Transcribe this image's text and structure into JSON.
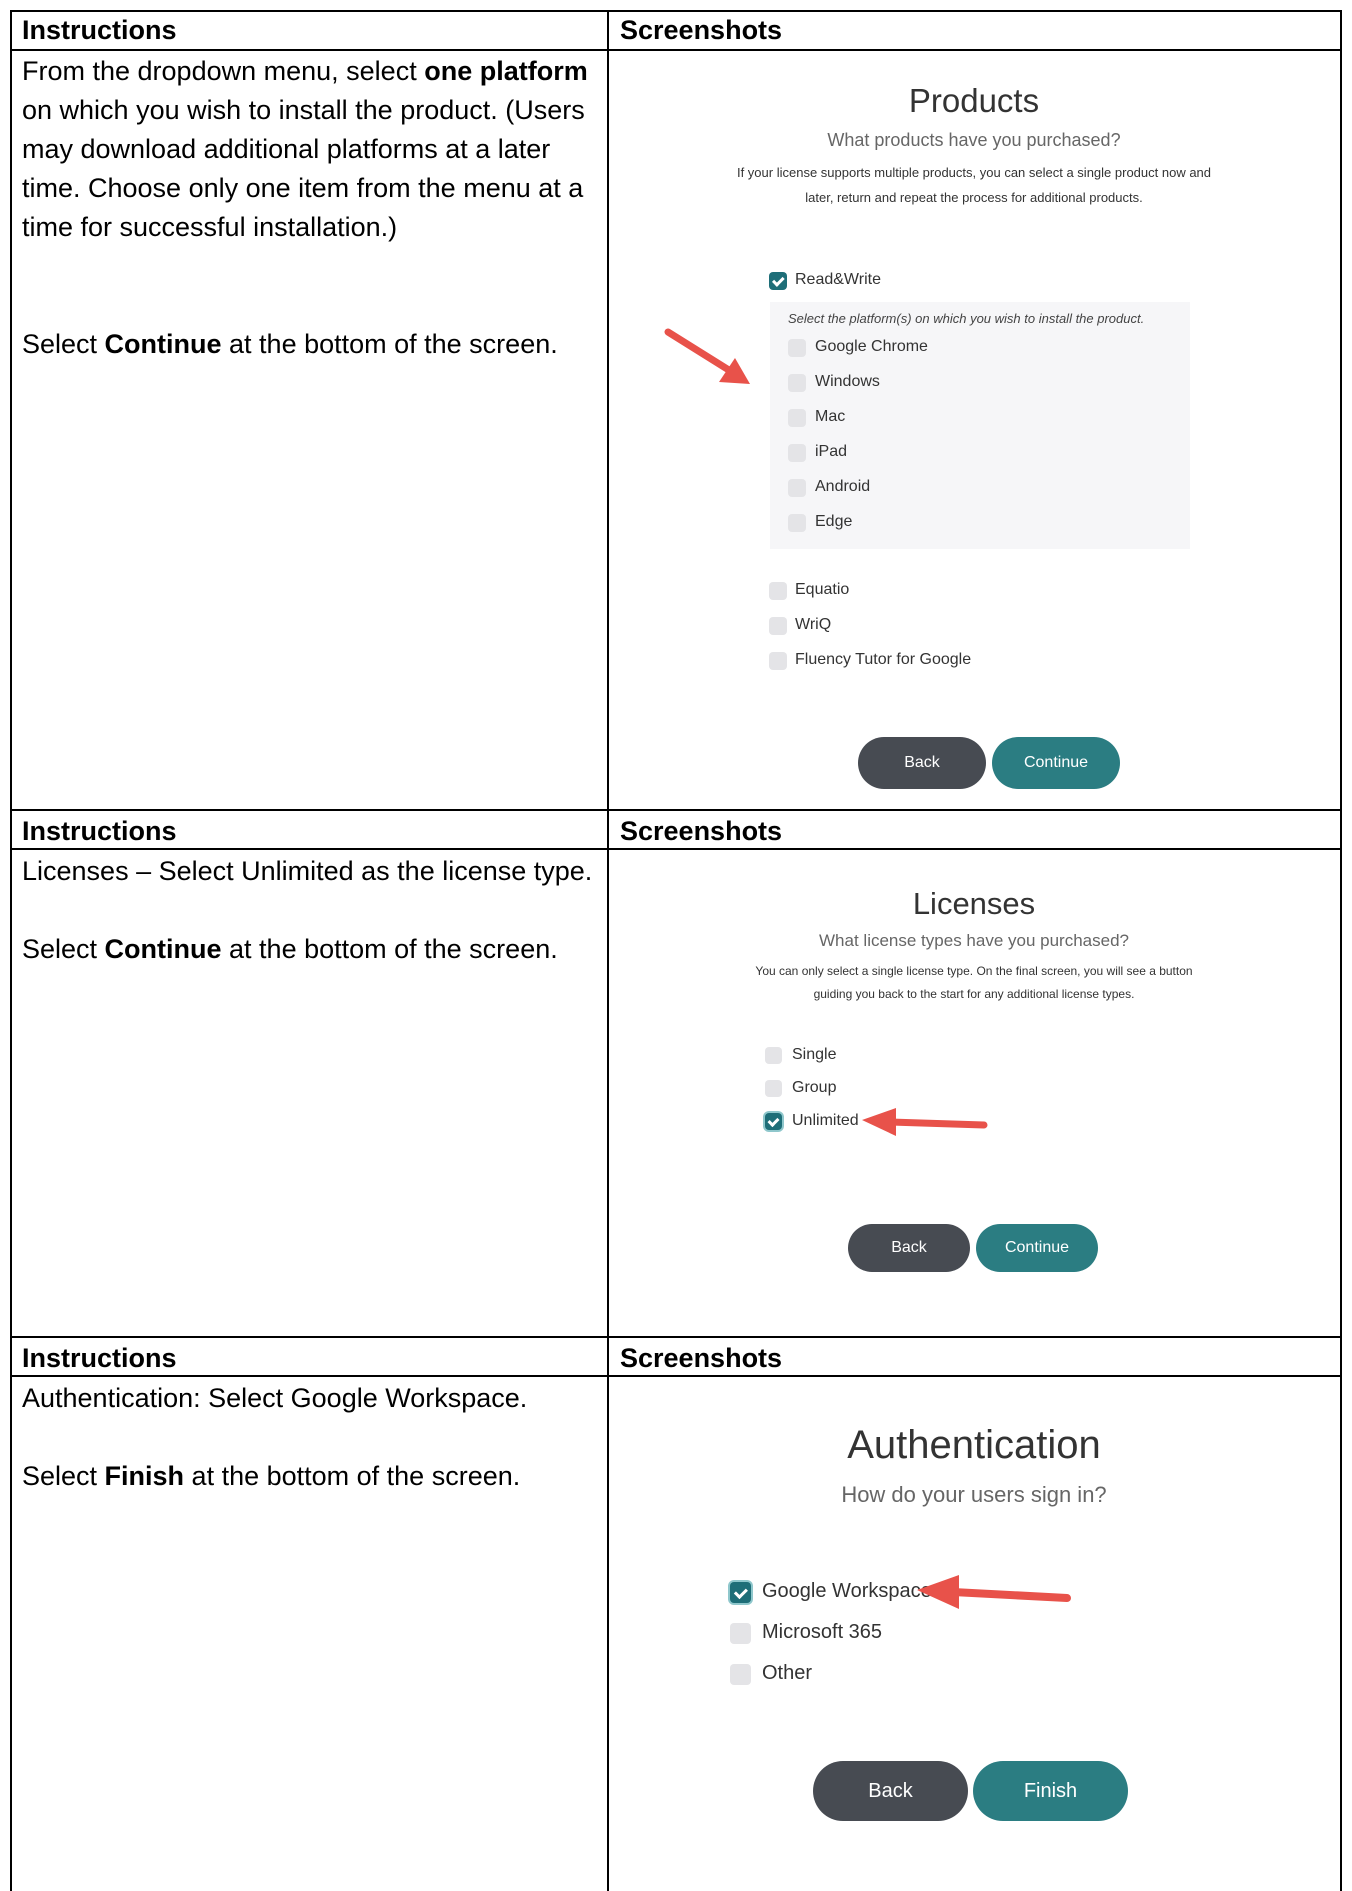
{
  "sections": [
    {
      "header_instructions": "Instructions",
      "header_screenshots": "Screenshots",
      "instructions": {
        "p1_a": "From the dropdown menu, select ",
        "p1_bold": "one platform",
        "p1_b": " on which you wish to install the product. (Users may download additional platforms at a later time. Choose only one item from the menu at a time for successful installation.)",
        "p2_a": "Select ",
        "p2_bold": "Continue",
        "p2_b": " at the bottom of the screen."
      },
      "screenshot": {
        "title": "Products",
        "subtitle": "What products have you purchased?",
        "description_line1": "If your license supports multiple products, you can select a single product now and",
        "description_line2": "later, return and repeat the process for additional products.",
        "product_checked": "Read&Write",
        "platform_prompt": "Select the platform(s) on which you wish to install the product.",
        "platforms": [
          "Google Chrome",
          "Windows",
          "Mac",
          "iPad",
          "Android",
          "Edge"
        ],
        "other_products": [
          "Equatio",
          "WriQ",
          "Fluency Tutor for Google"
        ],
        "back_label": "Back",
        "continue_label": "Continue"
      }
    },
    {
      "header_instructions": "Instructions",
      "header_screenshots": "Screenshots",
      "instructions": {
        "p1": "Licenses – Select Unlimited as the license type.",
        "p2_a": "Select ",
        "p2_bold": "Continue",
        "p2_b": " at the bottom of the screen."
      },
      "screenshot": {
        "title": "Licenses",
        "subtitle": "What license types have you purchased?",
        "description_line1": "You can only select a single license type. On the final screen, you will see a button",
        "description_line2": "guiding you back to the start for any additional license types.",
        "options": [
          "Single",
          "Group",
          "Unlimited"
        ],
        "selected_option": "Unlimited",
        "back_label": "Back",
        "continue_label": "Continue"
      }
    },
    {
      "header_instructions": "Instructions",
      "header_screenshots": "Screenshots",
      "instructions": {
        "p1": "Authentication: Select Google Workspace.",
        "p2_a": "Select ",
        "p2_bold": "Finish",
        "p2_b": " at the bottom of the screen."
      },
      "screenshot": {
        "title": "Authentication",
        "subtitle": "How do your users sign in?",
        "options": [
          "Google Workspace",
          "Microsoft 365",
          "Other"
        ],
        "selected_option": "Google Workspace",
        "back_label": "Back",
        "finish_label": "Finish"
      }
    }
  ],
  "colors": {
    "teal_checked": "#1e6e78",
    "continue_button": "#2b7d82",
    "back_button": "#474b52",
    "arrow": "#e8524a"
  }
}
